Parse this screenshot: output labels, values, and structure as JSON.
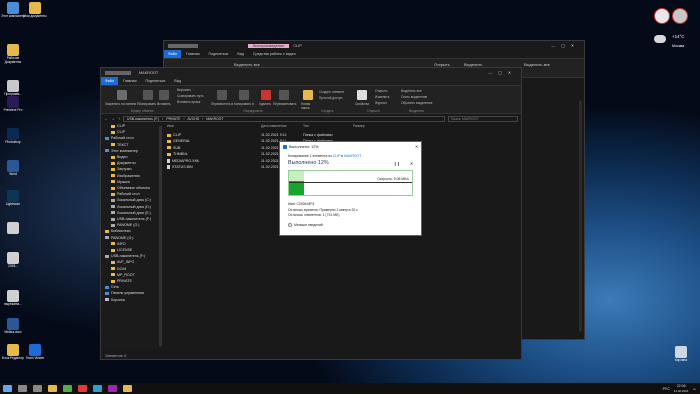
{
  "desktop": {
    "icons_left": [
      {
        "label": "Этот компьютер",
        "color": "#4a8fd6"
      },
      {
        "label": "Рабочие Документы",
        "color": "#e6b94a"
      },
      {
        "label": "Программ...",
        "color": "#c8c8c8"
      },
      {
        "label": "Premiere Pro",
        "color": "#2a1a55"
      },
      {
        "label": "Photoshop",
        "color": "#0a2a55"
      },
      {
        "label": "Word",
        "color": "#2b5797"
      },
      {
        "label": "Lightroom",
        "color": "#0d3556"
      },
      {
        "label": "",
        "color": "#d0d0d0"
      },
      {
        "label": "2035...",
        "color": "#d0d0d0"
      },
      {
        "label": "вырежена...",
        "color": "#d0d0d0"
      },
      {
        "label": "Мейка.docx",
        "color": "#2b5797"
      },
      {
        "label": "Блок Редактор",
        "color": "#e6b94a"
      }
    ],
    "icons_col2": [
      {
        "label": "Мои документы",
        "color": "#e6b94a"
      },
      {
        "label": "Team Viewer",
        "color": "#1e6bd6"
      }
    ],
    "recycle": "Корзина",
    "weather": {
      "temp": "+14°C",
      "place": "Москва"
    }
  },
  "back_window": {
    "tabs": [
      "Файл",
      "Главная",
      "Поделиться",
      "Вид"
    ],
    "context_tab": "Воспроизведение",
    "path_title": "CLIP",
    "context_menu": "Средства работы с видео",
    "ribbon": [
      "Выделить все",
      "Открыть",
      "Выделить",
      "Выделить все"
    ]
  },
  "front_window": {
    "title": "MAKROOT",
    "tabs": [
      "Файл",
      "Главная",
      "Поделиться",
      "Вид"
    ],
    "ribbon_groups": [
      "Буфер обмена",
      "Упорядочить",
      "Создать",
      "Открыть",
      "Выделить"
    ],
    "ribbon_labels": {
      "pin": "Закрепить на панели быстрого доступа",
      "copy": "Копировать",
      "paste": "Вставить",
      "cut": "Вырезать",
      "copy_path": "Скопировать путь",
      "paste_shortcut": "Вставить ярлык",
      "move": "Переместить в",
      "copy_to": "Копировать в",
      "delete": "Удалить",
      "rename": "Переименовать",
      "new_folder": "Новая папка",
      "new_item": "Создать элемент",
      "easy_access": "Простой доступ",
      "properties": "Свойства",
      "open": "Открыть",
      "edit": "Изменить",
      "history": "Журнал",
      "select_all": "Выделить все",
      "select_none": "Снять выделение",
      "invert": "Обратить выделение"
    },
    "breadcrumb": [
      "USB-накопитель (F:)",
      "PRIVATE",
      "AVCHD",
      "MAKROOT"
    ],
    "search_placeholder": "Поиск: MAKROOT",
    "nav": [
      {
        "label": "CLIP",
        "indent": 1,
        "icon": "folder"
      },
      {
        "label": "CLIP",
        "indent": 1,
        "icon": "folder"
      },
      {
        "label": "Рабочий стол",
        "indent": 0,
        "icon": "desktop"
      },
      {
        "label": "ТЕКСТ",
        "indent": 1,
        "icon": "folder"
      },
      {
        "label": "Этот компьютер",
        "indent": 0,
        "icon": "pc"
      },
      {
        "label": "Видео",
        "indent": 1,
        "icon": "folder"
      },
      {
        "label": "Документы",
        "indent": 1,
        "icon": "folder"
      },
      {
        "label": "Загрузки",
        "indent": 1,
        "icon": "folder"
      },
      {
        "label": "Изображения",
        "indent": 1,
        "icon": "folder"
      },
      {
        "label": "Музыка",
        "indent": 1,
        "icon": "folder"
      },
      {
        "label": "Объемные объекты",
        "indent": 1,
        "icon": "folder"
      },
      {
        "label": "Рабочий стол",
        "indent": 1,
        "icon": "folder"
      },
      {
        "label": "Локальный диск (C:)",
        "indent": 1,
        "icon": "drive"
      },
      {
        "label": "Локальный диск (D:)",
        "indent": 1,
        "icon": "drive"
      },
      {
        "label": "Локальный диск (E:)",
        "indent": 1,
        "icon": "drive"
      },
      {
        "label": "USB-накопитель (F:)",
        "indent": 1,
        "icon": "usb"
      },
      {
        "label": "PANOME (G:)",
        "indent": 1,
        "icon": "drive"
      },
      {
        "label": "Библиотеки",
        "indent": 0,
        "icon": "lib"
      },
      {
        "label": "PANOME (G:)",
        "indent": 0,
        "icon": "drive"
      },
      {
        "label": "INFO",
        "indent": 1,
        "icon": "folder"
      },
      {
        "label": "LICENSE",
        "indent": 1,
        "icon": "folder"
      },
      {
        "label": "USB-накопитель (F:)",
        "indent": 0,
        "icon": "usb"
      },
      {
        "label": "AVF_INFO",
        "indent": 1,
        "icon": "folder"
      },
      {
        "label": "DCIM",
        "indent": 1,
        "icon": "folder"
      },
      {
        "label": "MP_ROOT",
        "indent": 1,
        "icon": "folder"
      },
      {
        "label": "PRIVATE",
        "indent": 1,
        "icon": "folder"
      },
      {
        "label": "Сеть",
        "indent": 0,
        "icon": "net"
      },
      {
        "label": "Панель управления",
        "indent": 0,
        "icon": "cp"
      },
      {
        "label": "Корзина",
        "indent": 0,
        "icon": "bin"
      }
    ],
    "columns": [
      "Имя",
      "Дата изменения",
      "Тип",
      "Размер"
    ],
    "files": [
      {
        "name": "CLIP",
        "date": "11.02.2021 9:11",
        "type": "Папка с файлами",
        "size": "",
        "kind": "folder"
      },
      {
        "name": "GENERAL",
        "date": "11.02.2021 9:11",
        "type": "Папка с файлами",
        "size": "",
        "kind": "folder"
      },
      {
        "name": "SUB",
        "date": "11.02.2021 9:11",
        "type": "Папка с файлами",
        "size": "",
        "kind": "folder"
      },
      {
        "name": "THMBNL",
        "date": "11.02.2021 9:11",
        "type": "Папка с файлами",
        "size": "",
        "kind": "folder"
      },
      {
        "name": "MEDIAPRO.XML",
        "date": "11.02.2021 9:11",
        "type": "",
        "size": "",
        "kind": "doc"
      },
      {
        "name": "STATUS.BIN",
        "date": "11.02.2021 9:11",
        "type": "",
        "size": "",
        "kind": "doc"
      }
    ],
    "status": "Элементов: 6"
  },
  "copy_dialog": {
    "title": "Выполнено: 12%",
    "from_text": "Копирование 1 элемента из",
    "from": "CLIP",
    "to_word": "в",
    "to": "MAKROOT",
    "headline": "Выполнено 12%",
    "progress": 0.12,
    "speed": "Скорость: 9,08 МБ/с",
    "name": "Имя: C0006.MP4",
    "remaining_time": "Осталось времени: Примерно 1 минута 20 с",
    "remaining_items": "Осталось элементов: 1 (741 МБ)",
    "less": "Меньше сведений"
  },
  "taskbar": {
    "time": "22:06",
    "date": "11.02.2021",
    "lang": "РУС",
    "icons": [
      {
        "name": "windows-start-icon",
        "color": "#5fa8ff"
      },
      {
        "name": "search-icon",
        "color": "#888"
      },
      {
        "name": "task-view-icon",
        "color": "#888"
      },
      {
        "name": "explorer-icon",
        "color": "#e6b94a"
      },
      {
        "name": "chrome-icon",
        "color": "#4caf50"
      },
      {
        "name": "opera-icon",
        "color": "#e53935"
      },
      {
        "name": "telegram-icon",
        "color": "#2aa1d8"
      },
      {
        "name": "app-icon",
        "color": "#9c27b0"
      },
      {
        "name": "explorer-active-icon",
        "color": "#e6b94a"
      }
    ]
  }
}
